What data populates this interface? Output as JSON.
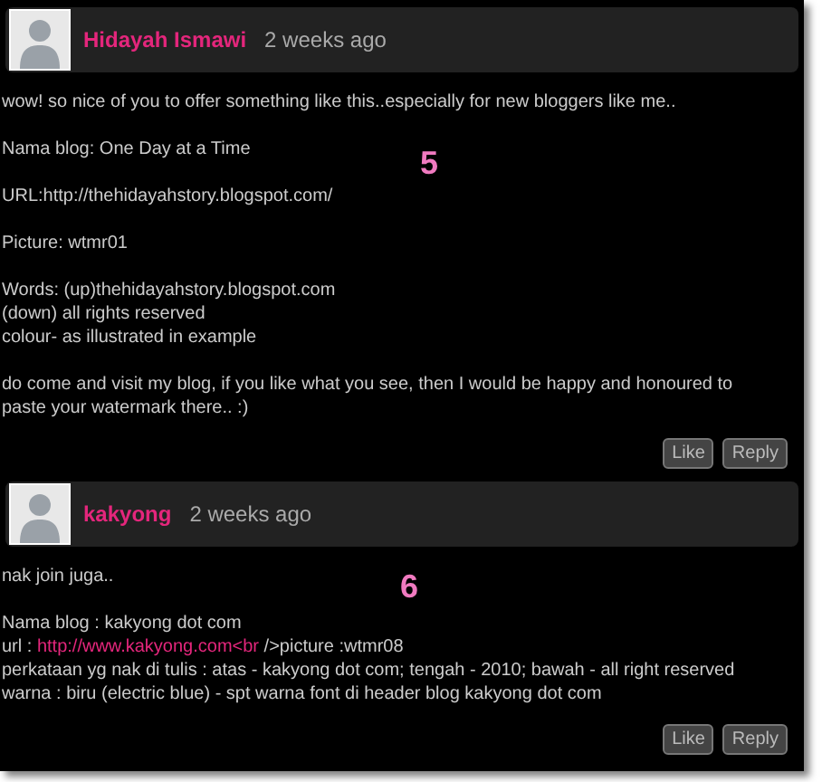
{
  "comments": [
    {
      "author": "Hidayah Ismawi",
      "time": "2 weeks ago",
      "annotation": "5",
      "paragraphs": [
        [
          "wow! so nice of you to offer something like this..especially for new bloggers like me.."
        ],
        [
          "Nama blog: One Day at a Time"
        ],
        [
          "URL:http://thehidayahstory.blogspot.com/"
        ],
        [
          "Picture: wtmr01"
        ],
        [
          "Words: (up)thehidayahstory.blogspot.com",
          "(down) all rights reserved",
          "colour- as illustrated in example"
        ],
        [
          "do come and visit my blog, if you like what you see, then I would be happy and honoured to paste your watermark there.. :)"
        ]
      ],
      "buttons": [
        "Like",
        "Reply"
      ]
    },
    {
      "author": "kakyong",
      "time": "2 weeks ago",
      "annotation": "6",
      "paragraphs": [
        [
          "nak join juga.."
        ],
        [
          "Nama blog : kakyong dot com",
          {
            "before": "url : ",
            "link": "http://www.kakyong.com<br",
            "after": " />picture :wtmr08"
          },
          "perkataan yg nak di tulis : atas - kakyong dot com; tengah - 2010; bawah - all right reserved",
          "warna : biru (electric blue) - spt warna font di header blog kakyong dot com"
        ]
      ],
      "buttons": [
        "Like",
        "Reply"
      ]
    }
  ]
}
